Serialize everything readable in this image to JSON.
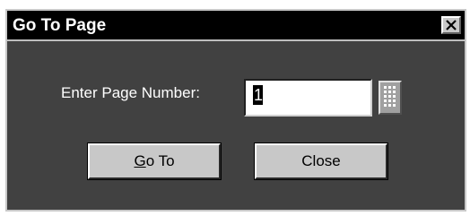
{
  "dialog": {
    "title": "Go To Page",
    "close_icon": "close-x-icon",
    "page_number_label": "Enter Page Number:",
    "page_number_value": "1",
    "keypad_icon": "keypad-grid-icon",
    "goto_button": {
      "label_mnemonic": "G",
      "label_rest": "o To"
    },
    "close_button": {
      "label": "Close"
    }
  }
}
